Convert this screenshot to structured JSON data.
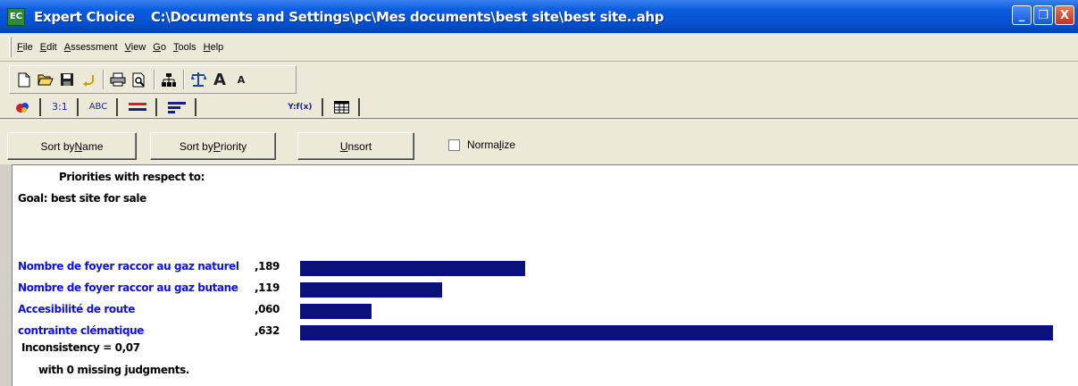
{
  "window": {
    "app_name": "Expert Choice",
    "file_path": "C:\\Documents and Settings\\pc\\Mes documents\\best site\\best site..ahp",
    "icon_text": "EC",
    "minimize_glyph": "_",
    "maximize_glyph": "❐",
    "close_glyph": "X"
  },
  "menu": [
    {
      "pre": "",
      "ul": "F",
      "post": "ile"
    },
    {
      "pre": "",
      "ul": "E",
      "post": "dit"
    },
    {
      "pre": "",
      "ul": "A",
      "post": "ssessment"
    },
    {
      "pre": "",
      "ul": "V",
      "post": "iew"
    },
    {
      "pre": "",
      "ul": "G",
      "post": "o"
    },
    {
      "pre": "",
      "ul": "T",
      "post": "ools"
    },
    {
      "pre": "",
      "ul": "H",
      "post": "elp"
    }
  ],
  "toolbar_icons": [
    "new-icon",
    "open-icon",
    "save-icon",
    "undo-icon",
    "print-icon",
    "print-preview-icon",
    "hierarchy-icon",
    "balance-icon",
    "increase-font-icon",
    "decrease-font-icon"
  ],
  "tabs": [
    {
      "name": "tab-people",
      "label": "🎨"
    },
    {
      "name": "tab-numerical",
      "label": "3:1"
    },
    {
      "name": "tab-verbal",
      "label": "ABC"
    },
    {
      "name": "tab-graphical",
      "label": "▬"
    },
    {
      "name": "tab-bars",
      "label": "≡"
    },
    {
      "name": "tab-formula",
      "label": "Y:f(x)"
    },
    {
      "name": "tab-grid",
      "label": "▦"
    }
  ],
  "buttons": {
    "sort_name_pre": "Sort by ",
    "sort_name_ul": "N",
    "sort_name_post": "ame",
    "sort_priority_pre": "Sort by ",
    "sort_priority_ul": "P",
    "sort_priority_post": "riority",
    "unsort_pre": "",
    "unsort_ul": "U",
    "unsort_post": "nsort",
    "normalize_pre": "Norma",
    "normalize_ul": "l",
    "normalize_post": "ize",
    "normalize_checked": false
  },
  "content": {
    "heading": "Priorities with respect to:",
    "goal": "Goal: best site for sale",
    "inconsistency": "Inconsistency = 0,07",
    "missing": "with 0  missing judgments.",
    "bar_color": "#0a1178",
    "label_color": "#1010e0"
  },
  "chart_data": {
    "type": "bar",
    "categories": [
      "Nombre de foyer raccor au gaz naturel",
      "Nombre de foyer raccor au gaz butane",
      "Accesibilité de route",
      "contrainte clématique"
    ],
    "value_labels": [
      ",189",
      ",119",
      ",060",
      ",632"
    ],
    "values": [
      0.189,
      0.119,
      0.06,
      0.632
    ],
    "xlim": [
      0,
      0.632
    ]
  }
}
